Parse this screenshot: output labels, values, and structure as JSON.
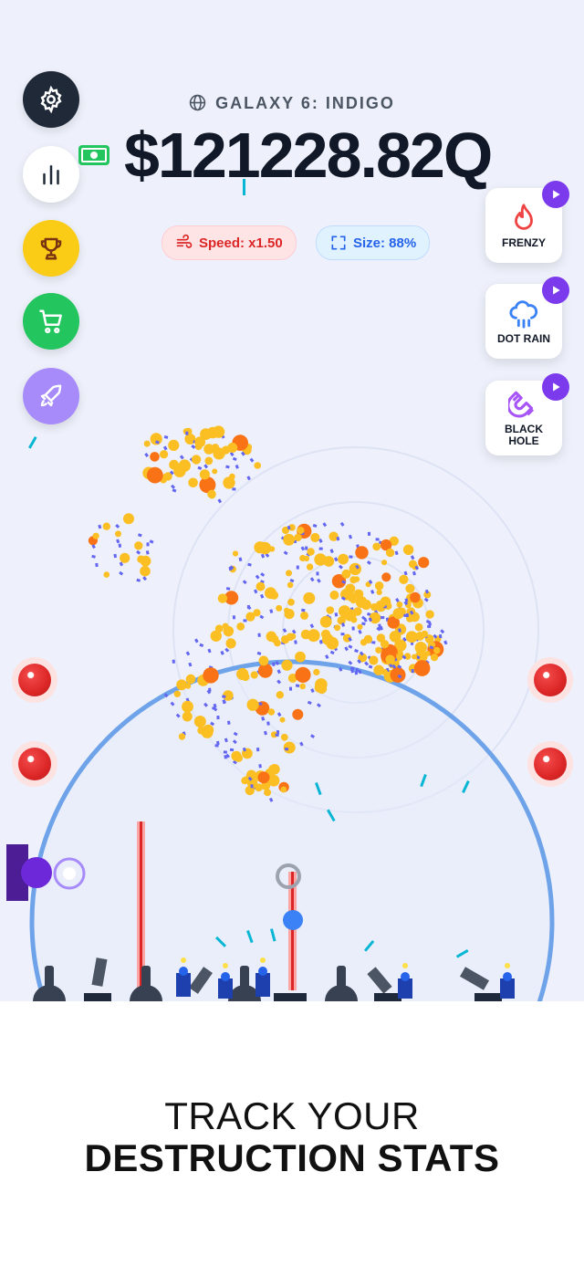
{
  "header": {
    "galaxy_label": "GALAXY 6: INDIGO",
    "money": "$121228.82Q"
  },
  "stats": {
    "speed_label": "Speed: x1.50",
    "size_label": "Size: 88%"
  },
  "menu": [
    {
      "name": "settings",
      "icon": "gear-icon",
      "color": "#1f2937"
    },
    {
      "name": "stats",
      "icon": "bar-chart-icon",
      "color": "#ffffff"
    },
    {
      "name": "trophy",
      "icon": "trophy-icon",
      "color": "#facc15"
    },
    {
      "name": "shop",
      "icon": "cart-icon",
      "color": "#22c55e"
    },
    {
      "name": "boost",
      "icon": "rocket-icon",
      "color": "#a78bfa"
    }
  ],
  "powerups": {
    "frenzy": {
      "label": "FRENZY",
      "icon": "flame-icon",
      "color": "#ef4444"
    },
    "dot_rain": {
      "label": "DOT RAIN",
      "icon": "cloud-rain-icon",
      "color": "#3b82f6"
    },
    "black_hole": {
      "label": "BLACK HOLE",
      "icon": "magnet-icon",
      "color": "#a855f7"
    }
  },
  "caption": {
    "line1": "TRACK YOUR",
    "line2": "DESTRUCTION STATS"
  },
  "colors": {
    "background": "#eef1fb",
    "dots_primary": "#fbbf24",
    "dots_secondary": "#6366f1",
    "accent_purple": "#7c3aed",
    "arena_ring": "#6ea3ea"
  }
}
